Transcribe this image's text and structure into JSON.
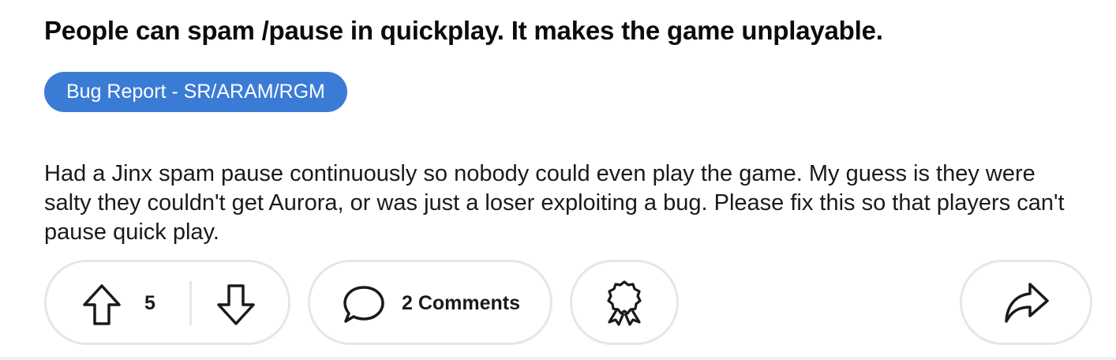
{
  "post": {
    "title": "People can spam /pause in quickplay. It makes the game unplayable.",
    "flair": "Bug Report - SR/ARAM/RGM",
    "body": "Had a Jinx spam pause continuously so nobody could even play the game. My guess is they were salty they couldn't get Aurora, or was just a loser exploiting a bug. Please fix this so that players can't pause quick play."
  },
  "actions": {
    "vote_count": "5",
    "comments_label": "2 Comments",
    "icons": {
      "upvote": "upvote-arrow-icon",
      "downvote": "downvote-arrow-icon",
      "comment": "speech-bubble-icon",
      "award": "award-ribbon-icon",
      "share": "share-arrow-icon"
    }
  },
  "colors": {
    "flair_bg": "#3a7bd5",
    "pill_border": "#e4e6e8"
  }
}
